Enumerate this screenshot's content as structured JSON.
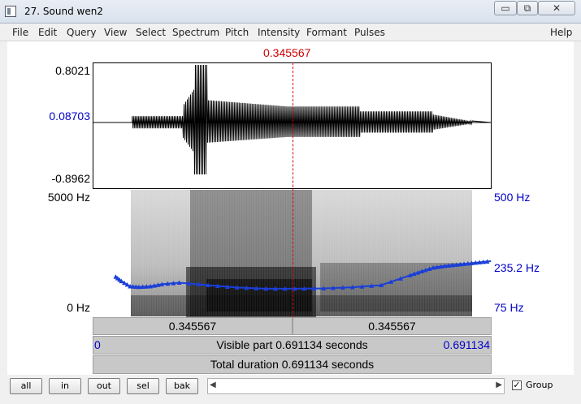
{
  "window": {
    "title": "27. Sound wen2",
    "minimize_glyph": "▭",
    "maximize_glyph": "⧉",
    "close_glyph": "✕"
  },
  "menu": {
    "items": [
      "File",
      "Edit",
      "Query",
      "View",
      "Select",
      "Spectrum",
      "Pitch",
      "Intensity",
      "Formant",
      "Pulses"
    ],
    "help": "Help"
  },
  "cursor": {
    "time_label": "0.345567",
    "fraction": 0.5
  },
  "waveform": {
    "max_label": "0.8021",
    "cursor_value_label": "0.08703",
    "min_label": "-0.8962"
  },
  "spectrogram": {
    "top_freq_label": "5000 Hz",
    "bottom_freq_label": "0 Hz",
    "pitch_top_label": "500 Hz",
    "pitch_cursor_label": "235.2 Hz",
    "pitch_bottom_label": "75 Hz",
    "pitch_track": {
      "range_hz": [
        75,
        500
      ],
      "t": [
        0.04,
        0.05,
        0.065,
        0.08,
        0.1,
        0.12,
        0.15,
        0.2,
        0.25,
        0.3,
        0.35,
        0.4,
        0.45,
        0.5,
        0.55,
        0.57,
        0.59,
        0.61,
        0.63,
        0.65,
        0.67,
        0.69
      ],
      "hz": [
        210,
        195,
        178,
        176,
        178,
        185,
        190,
        182,
        174,
        170,
        170,
        171,
        175,
        182,
        215,
        228,
        240,
        246,
        250,
        254,
        258,
        262
      ]
    }
  },
  "bars": {
    "left_selection": "0.345567",
    "right_selection": "0.345567",
    "visible_start": "0",
    "visible_label": "Visible part 0.691134 seconds",
    "visible_end": "0.691134",
    "total_label": "Total duration 0.691134 seconds"
  },
  "buttons": {
    "all": "all",
    "in": "in",
    "out": "out",
    "sel": "sel",
    "bak": "bak"
  },
  "scroll": {
    "left_arrow": "◀",
    "right_arrow": "▶"
  },
  "group": {
    "label": "Group",
    "checked": "✓"
  }
}
